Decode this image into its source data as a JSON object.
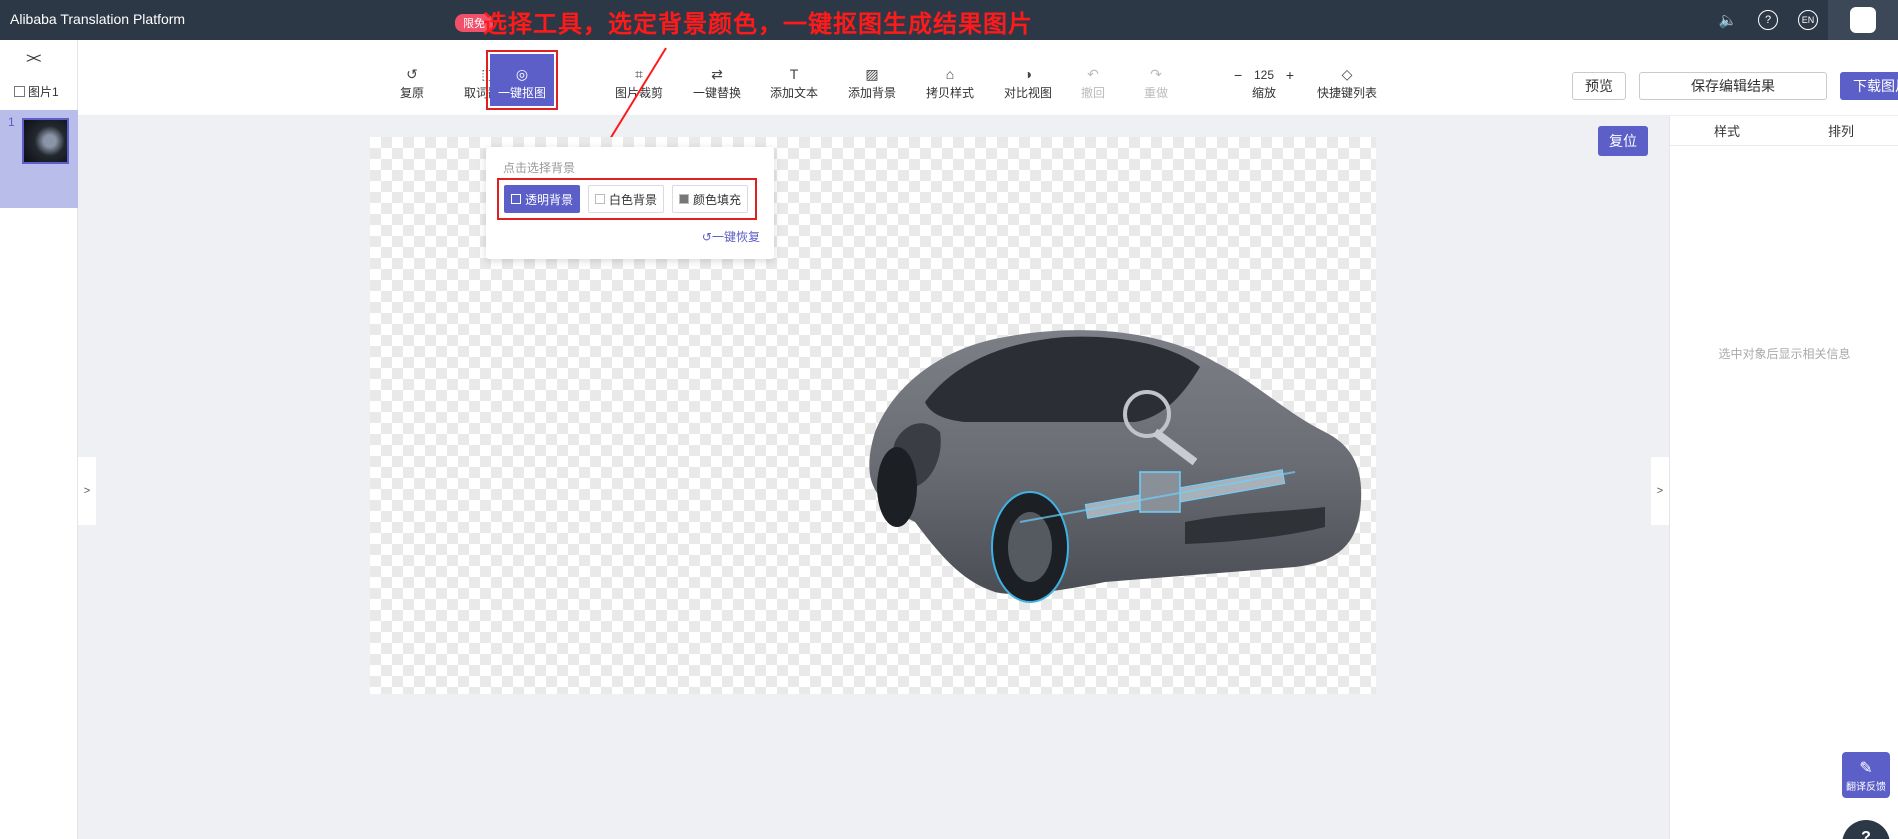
{
  "app": {
    "title": "Alibaba Translation Platform"
  },
  "header_icons": [
    {
      "name": "sound-icon",
      "glyph": "🔈"
    },
    {
      "name": "help-icon",
      "glyph": "?"
    },
    {
      "name": "language-icon",
      "glyph": "EN"
    }
  ],
  "sidebar": {
    "collapse_glyph": "><",
    "label": "图片1",
    "items": [
      {
        "num": "1"
      }
    ]
  },
  "toolbar": {
    "badge": "限免",
    "tools": [
      {
        "label": "复原",
        "icon": "↺"
      },
      {
        "label": "取词翻译",
        "icon": "⬚"
      },
      {
        "label": "一键抠图",
        "icon": "◎"
      },
      {
        "label": "图片裁剪",
        "icon": "⌗"
      },
      {
        "label": "一键替换",
        "icon": "⇄"
      },
      {
        "label": "添加文本",
        "icon": "T"
      },
      {
        "label": "添加背景",
        "icon": "▨"
      },
      {
        "label": "拷贝样式",
        "icon": "⌂"
      },
      {
        "label": "对比视图",
        "icon": "◑"
      },
      {
        "label": "撤回",
        "icon": "↶"
      },
      {
        "label": "重做",
        "icon": "↷"
      },
      {
        "label": "快捷键列表",
        "icon": "◇"
      }
    ],
    "zoom": {
      "value": "125",
      "label": "缩放",
      "minus": "−",
      "plus": "+"
    },
    "preview": "预览",
    "save": "保存编辑结果",
    "download": "下载图片",
    "download_caret": "⌄"
  },
  "annotation": "选择工具，选定背景颜色，一键抠图生成结果图片",
  "bg_panel": {
    "hint": "点击选择背景",
    "options": [
      {
        "label": "透明背景",
        "selected": true
      },
      {
        "label": "白色背景",
        "selected": false
      },
      {
        "label": "颜色填充",
        "selected": false
      }
    ],
    "restore": "一键恢复",
    "restore_icon": "↺"
  },
  "canvas": {
    "left_toggle": ">",
    "right_toggle": ">"
  },
  "reset_button": "复位",
  "right_panel": {
    "tabs": [
      "样式",
      "排列"
    ],
    "empty": "选中对象后显示相关信息"
  },
  "feedback": {
    "label": "翻译反馈",
    "icon": "✎"
  },
  "help_fab": "?"
}
